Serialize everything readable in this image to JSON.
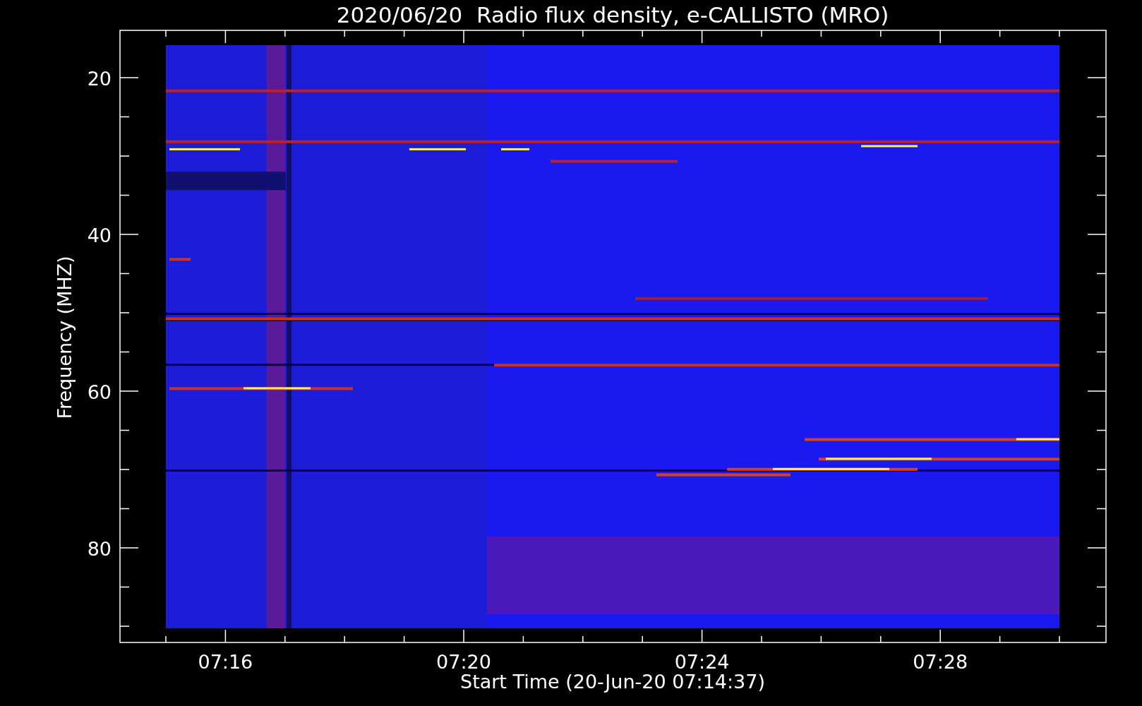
{
  "plot": {
    "title": "2020/06/20  Radio flux density, e-CALLISTO (MRO)",
    "y_axis": {
      "label": "Frequency (MHZ)",
      "tick_labels": [
        "20",
        "40",
        "60",
        "80"
      ]
    },
    "x_axis": {
      "label": "Start Time (20-Jun-20 07:14:37)",
      "tick_labels": [
        "07:16",
        "07:20",
        "07:24",
        "07:28"
      ]
    }
  }
}
